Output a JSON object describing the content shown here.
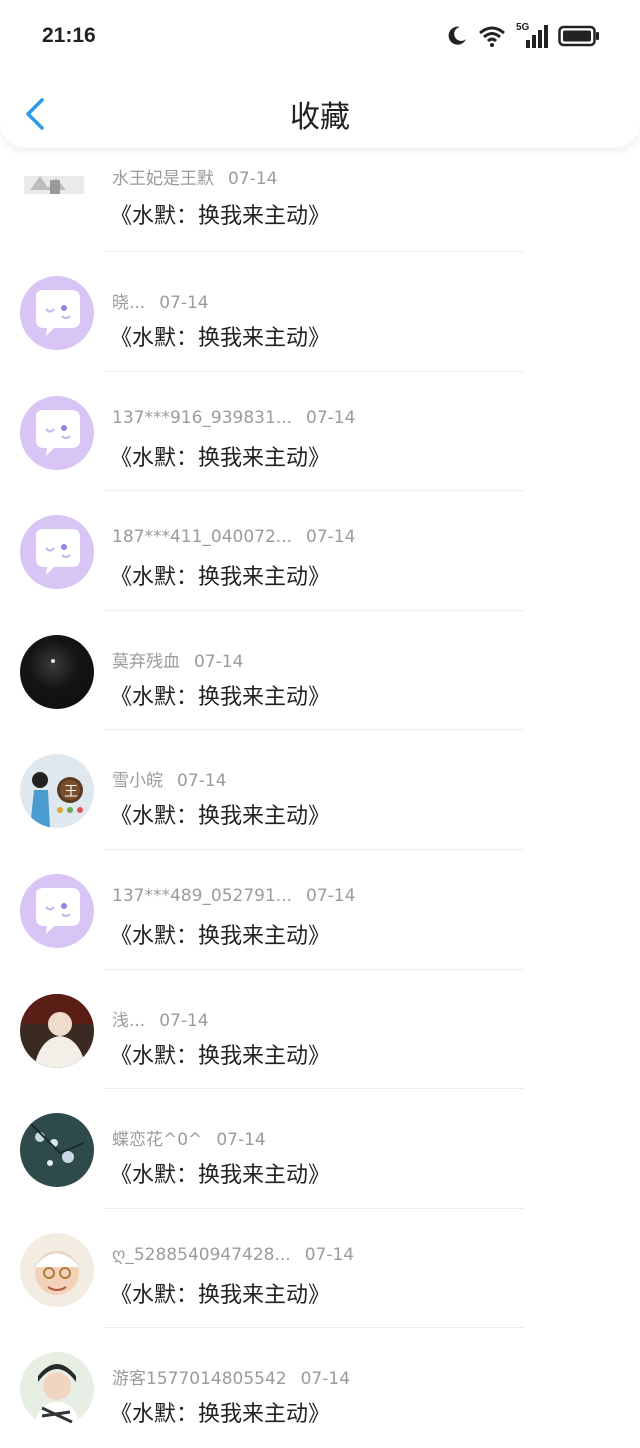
{
  "status": {
    "time": "21:16",
    "network": "5G"
  },
  "header": {
    "title": "收藏"
  },
  "items": [
    {
      "user": "水王妃是王默",
      "date": "07-14",
      "title": "《水默：换我来主动》",
      "avatar": "landscape"
    },
    {
      "user": "晓...",
      "date": "07-14",
      "title": "《水默：换我来主动》",
      "avatar": "default"
    },
    {
      "user": "137***916_939831...",
      "date": "07-14",
      "title": "《水默：换我来主动》",
      "avatar": "default"
    },
    {
      "user": "187***411_040072...",
      "date": "07-14",
      "title": "《水默：换我来主动》",
      "avatar": "default"
    },
    {
      "user": "莫弃残血",
      "date": "07-14",
      "title": "《水默：换我来主动》",
      "avatar": "dark"
    },
    {
      "user": "雪小皖",
      "date": "07-14",
      "title": "《水默：换我来主动》",
      "avatar": "wang"
    },
    {
      "user": "137***489_052791...",
      "date": "07-14",
      "title": "《水默：换我来主动》",
      "avatar": "default"
    },
    {
      "user": "浅...",
      "date": "07-14",
      "title": "《水默：换我来主动》",
      "avatar": "baby"
    },
    {
      "user": "蝶恋花^0^",
      "date": "07-14",
      "title": "《水默：换我来主动》",
      "avatar": "blossom"
    },
    {
      "user": "ღ_5288540947428...",
      "date": "07-14",
      "title": "《水默：换我来主动》",
      "avatar": "cartoon"
    },
    {
      "user": "游客1577014805542",
      "date": "07-14",
      "title": "《水默：换我来主动》",
      "avatar": "boy"
    }
  ]
}
